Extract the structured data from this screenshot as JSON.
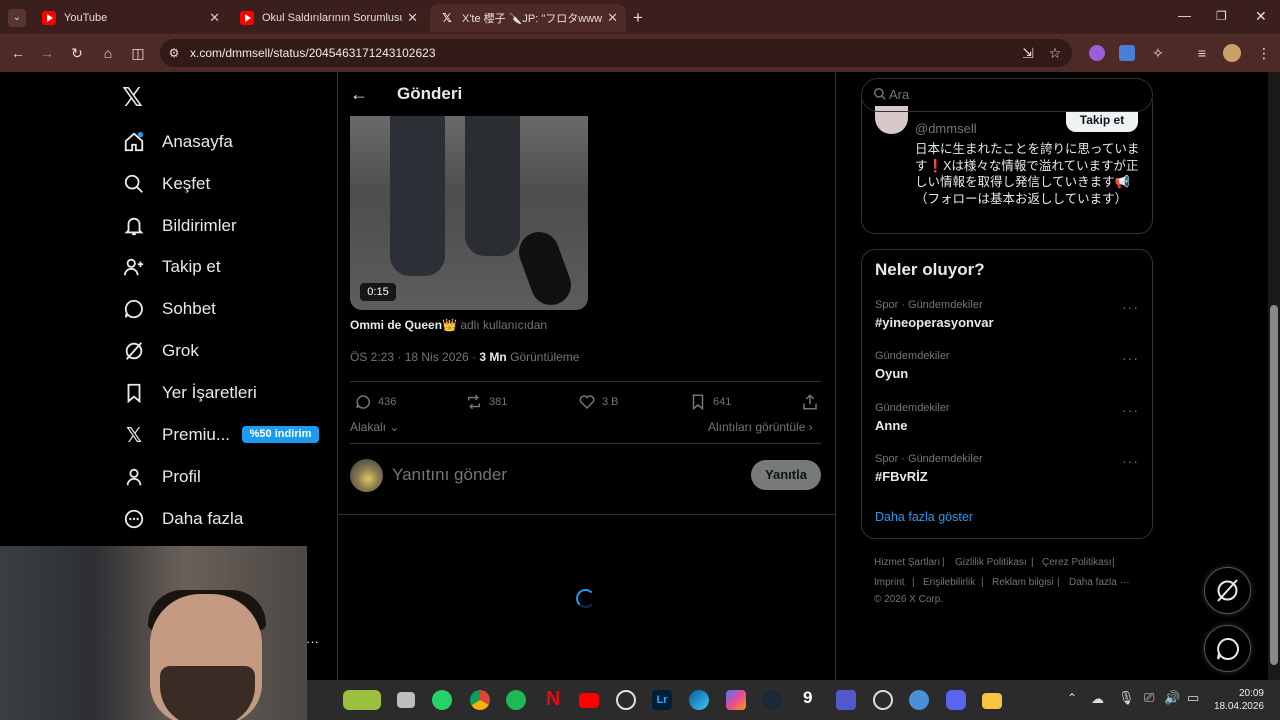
{
  "browser": {
    "tabs": [
      {
        "title": "YouTube",
        "icon": "youtube-icon"
      },
      {
        "title": "Okul Saldırılarının Sorumlusu A",
        "icon": "youtube-icon"
      },
      {
        "title": "X'te 櫻子 🔪JP: \"フロタwwwwwww",
        "icon": "x-logo-icon"
      }
    ],
    "url": "x.com/dmmsell/status/2045463171243102623"
  },
  "nav": {
    "items": [
      {
        "label": "Anasayfa",
        "icon": "home-icon"
      },
      {
        "label": "Keşfet",
        "icon": "search-icon"
      },
      {
        "label": "Bildirimler",
        "icon": "bell-icon"
      },
      {
        "label": "Takip et",
        "icon": "follow-icon"
      },
      {
        "label": "Sohbet",
        "icon": "chat-icon"
      },
      {
        "label": "Grok",
        "icon": "grok-icon"
      },
      {
        "label": "Yer İşaretleri",
        "icon": "bookmark-icon"
      },
      {
        "label": "Premiu...",
        "icon": "x-logo-icon"
      },
      {
        "label": "Profil",
        "icon": "profile-icon"
      },
      {
        "label": "Daha fazla",
        "icon": "more-icon"
      }
    ],
    "premium_badge": "%50 indirim"
  },
  "post": {
    "header_title": "Gönderi",
    "video_duration": "0:15",
    "attribution_name": "Ommi de Queen👑",
    "attribution_suffix": "adlı kullanıcıdan",
    "time": "ÖS 2:23 · 18 Nis 2026 ·",
    "views_count": "3 Mn",
    "views_label": "Görüntüleme",
    "replies": "436",
    "reposts": "381",
    "likes": "3 B",
    "bookmarks": "641",
    "sort_label": "Alakalı",
    "quotes_link": "Alıntıları görüntüle",
    "reply_placeholder": "Yanıtını gönder",
    "reply_button": "Yanıtla"
  },
  "right": {
    "search_placeholder": "Ara",
    "profile_handle": "@dmmsell",
    "follow_button": "Takip et",
    "bio": "日本に生まれたことを誇りに思っています❗️Xは様々な情報で溢れていますが正しい情報を取得し発信していきます📢（フォローは基本お返ししています）",
    "trends_title": "Neler oluyor?",
    "trends": [
      {
        "category": "Spor · Gündemdekiler",
        "name": "#yineoperasyonvar"
      },
      {
        "category": "Gündemdekiler",
        "name": "Oyun"
      },
      {
        "category": "Gündemdekiler",
        "name": "Anne"
      },
      {
        "category": "Spor · Gündemdekiler",
        "name": "#FBvRİZ"
      }
    ],
    "show_more": "Daha fazla göster",
    "footer": [
      "Hizmet Şartları",
      "Gizlilik Politikası",
      "Çerez Politikası",
      "Imprint",
      "Erişilebilirlik",
      "Reklam bilgisi",
      "Daha fazla ···"
    ],
    "copyright": "© 2026 X Corp."
  },
  "system": {
    "time": "20:09",
    "date": "18.04.2026"
  }
}
